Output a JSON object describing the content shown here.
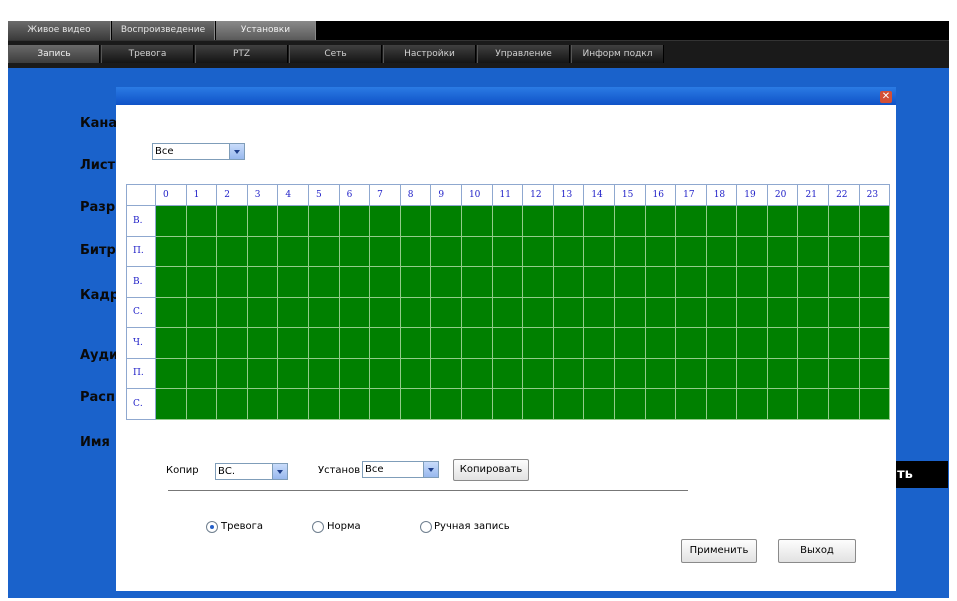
{
  "top_tabs": [
    "Живое видео",
    "Воспроизведение",
    "Установки"
  ],
  "sub_tabs": [
    "Запись",
    "Тревога",
    "PTZ",
    "Сеть",
    "Настройки",
    "Управление",
    "Информ подкл"
  ],
  "background_labels": [
    "Кана",
    "Лист",
    "Разр",
    "Битр",
    "Кадр",
    "Ауди",
    "Расп",
    "Имя"
  ],
  "save_button_label": "ить",
  "dialog": {
    "close_glyph": "✕",
    "top_select": {
      "value": "Все"
    },
    "hours": [
      "0",
      "1",
      "2",
      "3",
      "4",
      "5",
      "6",
      "7",
      "8",
      "9",
      "10",
      "11",
      "12",
      "13",
      "14",
      "15",
      "16",
      "17",
      "18",
      "19",
      "20",
      "21",
      "22",
      "23"
    ],
    "days": [
      "В.",
      "П.",
      "В.",
      "С.",
      "Ч.",
      "П.",
      "С."
    ],
    "cell_color": "#008000",
    "copy_label": "Копир",
    "copy_select": {
      "value": "ВС."
    },
    "set_label": "Установ",
    "set_select": {
      "value": "Все"
    },
    "copy_button": "Копировать",
    "radios": [
      {
        "label": "Тревога",
        "checked": true
      },
      {
        "label": "Норма",
        "checked": false
      },
      {
        "label": "Ручная запись",
        "checked": false
      }
    ],
    "apply_button": "Применить",
    "exit_button": "Выход"
  }
}
